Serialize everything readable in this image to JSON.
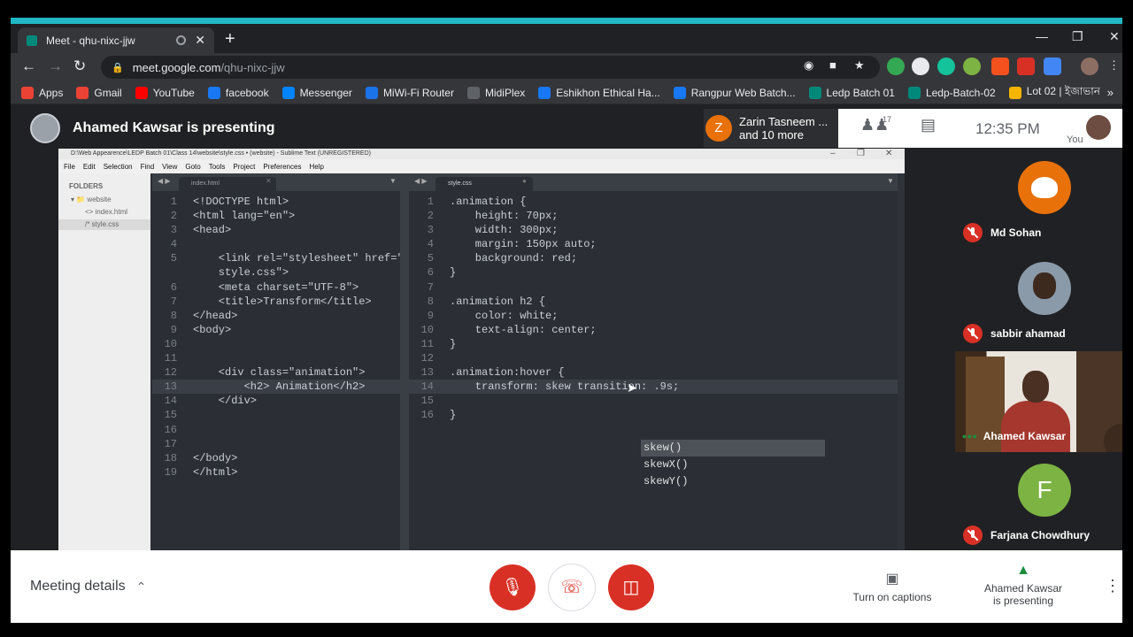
{
  "browser": {
    "tab_title": "Meet - qhu-nixc-jjw",
    "url_host": "meet.google.com",
    "url_path": "/qhu-nixc-jjw",
    "new_tab": "+",
    "tab_close": "✕"
  },
  "bookmarks": [
    {
      "label": "Apps",
      "color": "#ea4335",
      "icon": "apps-icon"
    },
    {
      "label": "Gmail",
      "color": "#ea4335",
      "icon": "gmail-icon"
    },
    {
      "label": "YouTube",
      "color": "#ff0000",
      "icon": "youtube-icon"
    },
    {
      "label": "facebook",
      "color": "#1877f2",
      "icon": "facebook-icon"
    },
    {
      "label": "Messenger",
      "color": "#0084ff",
      "icon": "messenger-icon"
    },
    {
      "label": "MiWi-Fi Router",
      "color": "#1a73e8",
      "icon": "wifi-icon"
    },
    {
      "label": "MidiPlex",
      "color": "#5f6368",
      "icon": "globe-icon"
    },
    {
      "label": "Eshikhon Ethical Ha...",
      "color": "#1877f2",
      "icon": "facebook-icon"
    },
    {
      "label": "Rangpur Web Batch...",
      "color": "#1877f2",
      "icon": "facebook-icon"
    },
    {
      "label": "Ledp Batch 01",
      "color": "#00897b",
      "icon": "meet-icon"
    },
    {
      "label": "Ledp-Batch-02",
      "color": "#00897b",
      "icon": "meet-icon"
    },
    {
      "label": "Lot 02 | ইজাভান",
      "color": "#f4b400",
      "icon": "lot-icon"
    }
  ],
  "meet": {
    "presenting_label": "Ahamed Kawsar is presenting",
    "notif_initial": "Z",
    "notif_line1": "Zarin Tasneem ...",
    "notif_line2": "and 10 more",
    "people_count": "17",
    "time": "12:35 PM",
    "you_label": "You"
  },
  "sublime": {
    "title": "D:\\Web Appearence\\LEDP Batch 01\\Class 14\\website\\style.css • (website) - Sublime Text (UNREGISTERED)",
    "menu": [
      "File",
      "Edit",
      "Selection",
      "Find",
      "View",
      "Goto",
      "Tools",
      "Project",
      "Preferences",
      "Help"
    ],
    "sidebar": {
      "header": "FOLDERS",
      "folder": "website",
      "files": [
        "index.html",
        "style.css"
      ]
    },
    "left_tab": "index.html",
    "right_tab": "style.css",
    "left_lines": [
      "<!DOCTYPE html>",
      "<html lang=\"en\">",
      "<head>",
      "",
      "    <link rel=\"stylesheet\" href=\"",
      "    style.css\">",
      "    <meta charset=\"UTF-8\">",
      "    <title>Transform</title>",
      "</head>",
      "<body>",
      "",
      "",
      "    <div class=\"animation\">",
      "        <h2> Animation</h2>",
      "    </div>",
      "",
      "",
      "",
      "</body>",
      "</html>"
    ],
    "left_numbers": [
      "1",
      "2",
      "3",
      "4",
      "5",
      "",
      "6",
      "7",
      "8",
      "9",
      "10",
      "11",
      "12",
      "13",
      "14",
      "15",
      "16",
      "17",
      "18",
      "19"
    ],
    "right_lines": [
      ".animation {",
      "    height: 70px;",
      "    width: 300px;",
      "    margin: 150px auto;",
      "    background: red;",
      "}",
      "",
      ".animation h2 {",
      "    color: white;",
      "    text-align: center;",
      "}",
      "",
      ".animation:hover {",
      "    transform: skew transition: .9s;",
      "",
      "}"
    ],
    "right_numbers": [
      "1",
      "2",
      "3",
      "4",
      "5",
      "6",
      "7",
      "8",
      "9",
      "10",
      "11",
      "12",
      "13",
      "14",
      "15",
      "16"
    ],
    "autocomplete": [
      "skew()",
      "skewX()",
      "skewY()"
    ]
  },
  "participants": [
    {
      "name": "Md Sohan",
      "initial": "",
      "color": "#e8710a"
    },
    {
      "name": "sabbir ahamad",
      "initial": "",
      "color": "#7a8a99"
    },
    {
      "name": "Ahamed Kawsar",
      "initial": "",
      "color": "#5a4a3c"
    },
    {
      "name": "Farjana Chowdhury",
      "initial": "F",
      "color": "#7cb342"
    }
  ],
  "bottom": {
    "meeting_details": "Meeting details",
    "captions": "Turn on captions",
    "presenting_line1": "Ahamed Kawsar",
    "presenting_line2": "is presenting"
  },
  "colors": {
    "accent": "#1fb8c4",
    "red": "#d93025",
    "meet_bg": "#202124"
  }
}
